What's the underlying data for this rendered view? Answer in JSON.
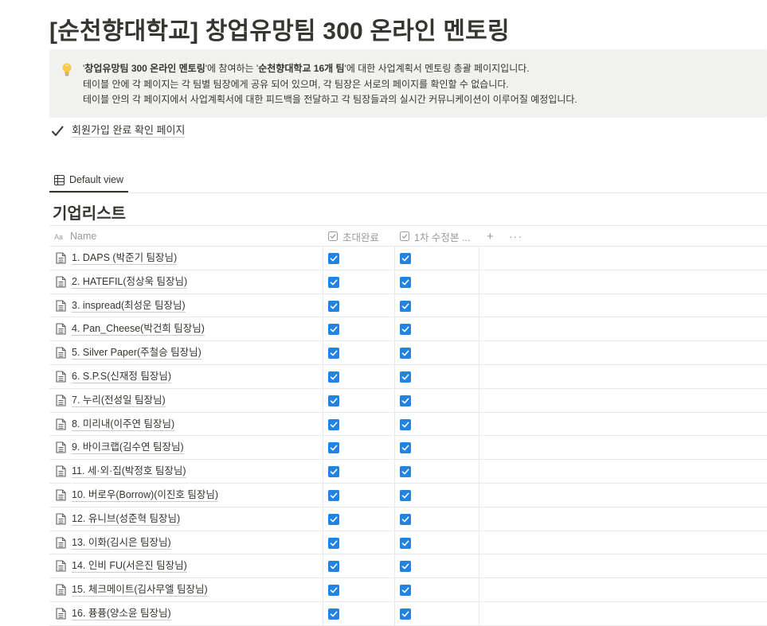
{
  "page": {
    "title": "[순천향대학교] 창업유망팀 300 온라인 멘토링"
  },
  "callout": {
    "icon": "lightbulb-icon",
    "line1": {
      "q1": "'",
      "b1": "창업유망팀 300 온라인 멘토링",
      "t1": "'에 참여하는 '",
      "b2": "순천향대학교 16개 팀",
      "t2": "'에 대한 사업계획서 멘토링 총괄 페이지입니다."
    },
    "line2": "테이블 안에 각 페이지는 각 팀별 팀장에게 공유 되어 있으며, 각 팀장은 서로의 페이지를 확인할 수 없습니다.",
    "line3": "테이블 안의 각 페이지에서 사업계획서에 대한 피드백을 전달하고 각 팀장들과의 실시간 커뮤니케이션이 이루어질 예정입니다."
  },
  "todo": {
    "icon": "checkmark-icon",
    "label": "회원가입 완료 확인 페이지"
  },
  "view": {
    "icon": "table-icon",
    "label": "Default view"
  },
  "database": {
    "title": "기업리스트",
    "columns": {
      "name": "Name",
      "a": "초대완료",
      "b": "1차 수정본 ...",
      "add": "+",
      "more": "···"
    },
    "rows": [
      {
        "name": "1. DAPS (박준기 팀장님)",
        "a": true,
        "b": true
      },
      {
        "name": "2. HATEFIL(정상욱 팀장님)",
        "a": true,
        "b": true
      },
      {
        "name": "3. inspread(최성운 팀장님)",
        "a": true,
        "b": true
      },
      {
        "name": "4. Pan_Cheese(박건희 팀장님)",
        "a": true,
        "b": true
      },
      {
        "name": "5. Silver Paper(주철승 팀장님)",
        "a": true,
        "b": true
      },
      {
        "name": "6. S.P.S(신재정 팀장님)",
        "a": true,
        "b": true
      },
      {
        "name": "7. 누리(전성일 팀장님)",
        "a": true,
        "b": true
      },
      {
        "name": "8. 미리내(이주연 팀장님)",
        "a": true,
        "b": true
      },
      {
        "name": "9. 바이크랩(김수연 팀장님)",
        "a": true,
        "b": true
      },
      {
        "name": "11. 세·외·집(박정호 팀장님)",
        "a": true,
        "b": true
      },
      {
        "name": "10. 버로우(Borrow)(이진호 팀장님)",
        "a": true,
        "b": true
      },
      {
        "name": "12. 유니브(성준혁 팀장님)",
        "a": true,
        "b": true
      },
      {
        "name": "13. 이화(김시은 팀장님)",
        "a": true,
        "b": true
      },
      {
        "name": "14. 인비 FU(서은진 팀장님)",
        "a": true,
        "b": true
      },
      {
        "name": "15. 체크메이트(김사무엘 팀장님)",
        "a": true,
        "b": true
      },
      {
        "name": "16. 퓽퓽(양소윤 팀장님)",
        "a": true,
        "b": true
      }
    ]
  },
  "colors": {
    "checkbox": "#2383e2",
    "text": "#37352f",
    "muted": "#9b9a97",
    "callout_bg": "#f1f1ef",
    "divider": "#e9e9e7"
  }
}
